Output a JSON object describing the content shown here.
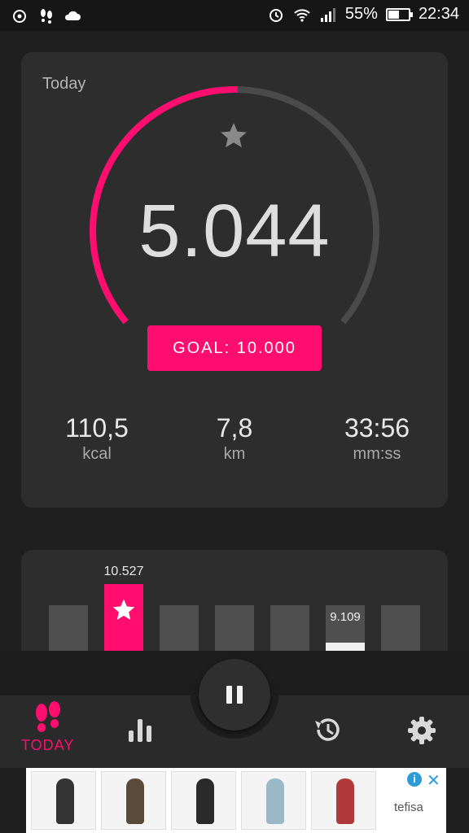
{
  "status_bar": {
    "battery": "55%",
    "time": "22:34",
    "battery_level": 0.55
  },
  "today": {
    "label": "Today",
    "steps": "5.044",
    "goal_label": "GOAL: 10.000",
    "progress": 0.5044,
    "accent": "#ff0d6f",
    "stats": [
      {
        "value": "110,5",
        "unit": "kcal"
      },
      {
        "value": "7,8",
        "unit": "km"
      },
      {
        "value": "33:56",
        "unit": "mm:ss"
      }
    ]
  },
  "week": {
    "bars": [
      {
        "label": "",
        "level": 0.55,
        "kind": "normal"
      },
      {
        "label": "10.527",
        "level": 0.8,
        "kind": "goal"
      },
      {
        "label": "",
        "level": 0.55,
        "kind": "normal"
      },
      {
        "label": "",
        "level": 0.55,
        "kind": "normal"
      },
      {
        "label": "",
        "level": 0.55,
        "kind": "normal"
      },
      {
        "label": "9.109",
        "level": 0.55,
        "kind": "current"
      },
      {
        "label": "",
        "level": 0.55,
        "kind": "normal"
      }
    ]
  },
  "nav": {
    "today_label": "TODAY",
    "items": [
      {
        "icon": "footprints-icon"
      },
      {
        "icon": "bar-chart-icon"
      },
      {
        "icon": "history-icon"
      },
      {
        "icon": "gear-icon"
      }
    ]
  },
  "ad": {
    "brand": "tefisa"
  }
}
